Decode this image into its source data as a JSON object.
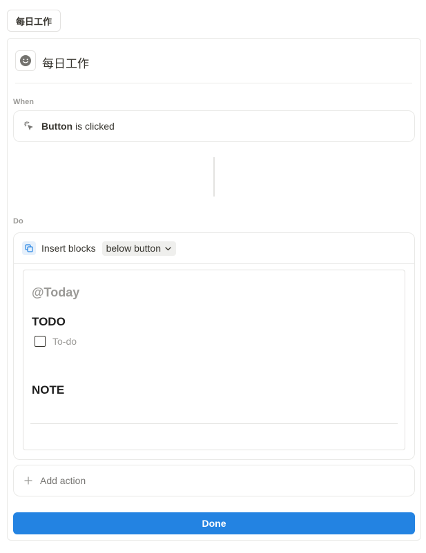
{
  "top_pill": {
    "label": "每日工作"
  },
  "header": {
    "title": "每日工作",
    "icon": "smiley-face-icon"
  },
  "when": {
    "section_label": "When",
    "trigger_bold": "Button",
    "trigger_rest": " is clicked",
    "icon": "click-cursor-icon"
  },
  "do": {
    "section_label": "Do",
    "action_label": "Insert blocks",
    "position_value": "below button",
    "icon": "copy-blocks-icon",
    "template": {
      "mention": "@Today",
      "heading_1": "TODO",
      "todo_placeholder": "To-do",
      "heading_2": "NOTE"
    }
  },
  "add_action": {
    "label": "Add action",
    "icon": "plus-icon"
  },
  "done": {
    "label": "Done"
  },
  "colors": {
    "accent": "#2383e2",
    "text": "#37352f",
    "muted": "#9b9a97"
  }
}
